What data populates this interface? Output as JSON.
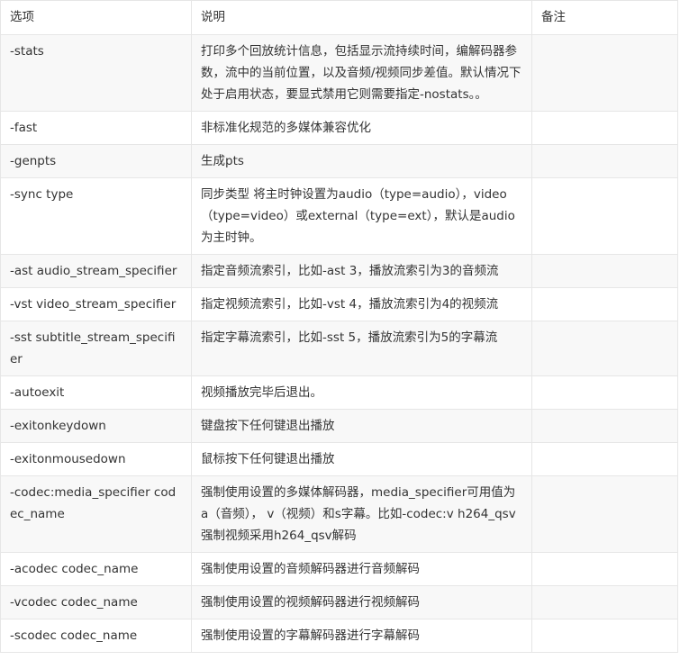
{
  "table": {
    "headers": [
      "选项",
      "说明",
      "备注"
    ],
    "rows": [
      {
        "option": "-stats",
        "desc": "打印多个回放统计信息，包括显示流持续时间，编解码器参数，流中的当前位置，以及音频/视频同步差值。默认情况下处于启用状态，要显式禁用它则需要指定-nostats。。",
        "note": ""
      },
      {
        "option": "-fast",
        "desc": "非标准化规范的多媒体兼容优化",
        "note": ""
      },
      {
        "option": "-genpts",
        "desc": "生成pts",
        "note": ""
      },
      {
        "option": "-sync type",
        "desc": "同步类型 将主时钟设置为audio（type=audio），video（type=video）或external（type=ext），默认是audio为主时钟。",
        "note": ""
      },
      {
        "option": "-ast audio_stream_specifier",
        "desc": "指定音频流索引，比如-ast 3，播放流索引为3的音频流",
        "note": ""
      },
      {
        "option": "-vst video_stream_specifier",
        "desc": "指定视频流索引，比如-vst 4，播放流索引为4的视频流",
        "note": ""
      },
      {
        "option": "-sst subtitle_stream_specifier",
        "desc": "指定字幕流索引，比如-sst 5，播放流索引为5的字幕流",
        "note": ""
      },
      {
        "option": "-autoexit",
        "desc": "视频播放完毕后退出。",
        "note": ""
      },
      {
        "option": "-exitonkeydown",
        "desc": "键盘按下任何键退出播放",
        "note": ""
      },
      {
        "option": "-exitonmousedown",
        "desc": "鼠标按下任何键退出播放",
        "note": ""
      },
      {
        "option": "-codec:media_specifier codec_name",
        "desc": "强制使用设置的多媒体解码器，media_specifier可用值为a（音频）， v（视频）和s字幕。比如-codec:v h264_qsv 强制视频采用h264_qsv解码",
        "note": ""
      },
      {
        "option": "-acodec codec_name",
        "desc": "强制使用设置的音频解码器进行音频解码",
        "note": ""
      },
      {
        "option": "-vcodec codec_name",
        "desc": "强制使用设置的视频解码器进行视频解码",
        "note": ""
      },
      {
        "option": "-scodec codec_name",
        "desc": "强制使用设置的字幕解码器进行字幕解码",
        "note": ""
      }
    ]
  }
}
